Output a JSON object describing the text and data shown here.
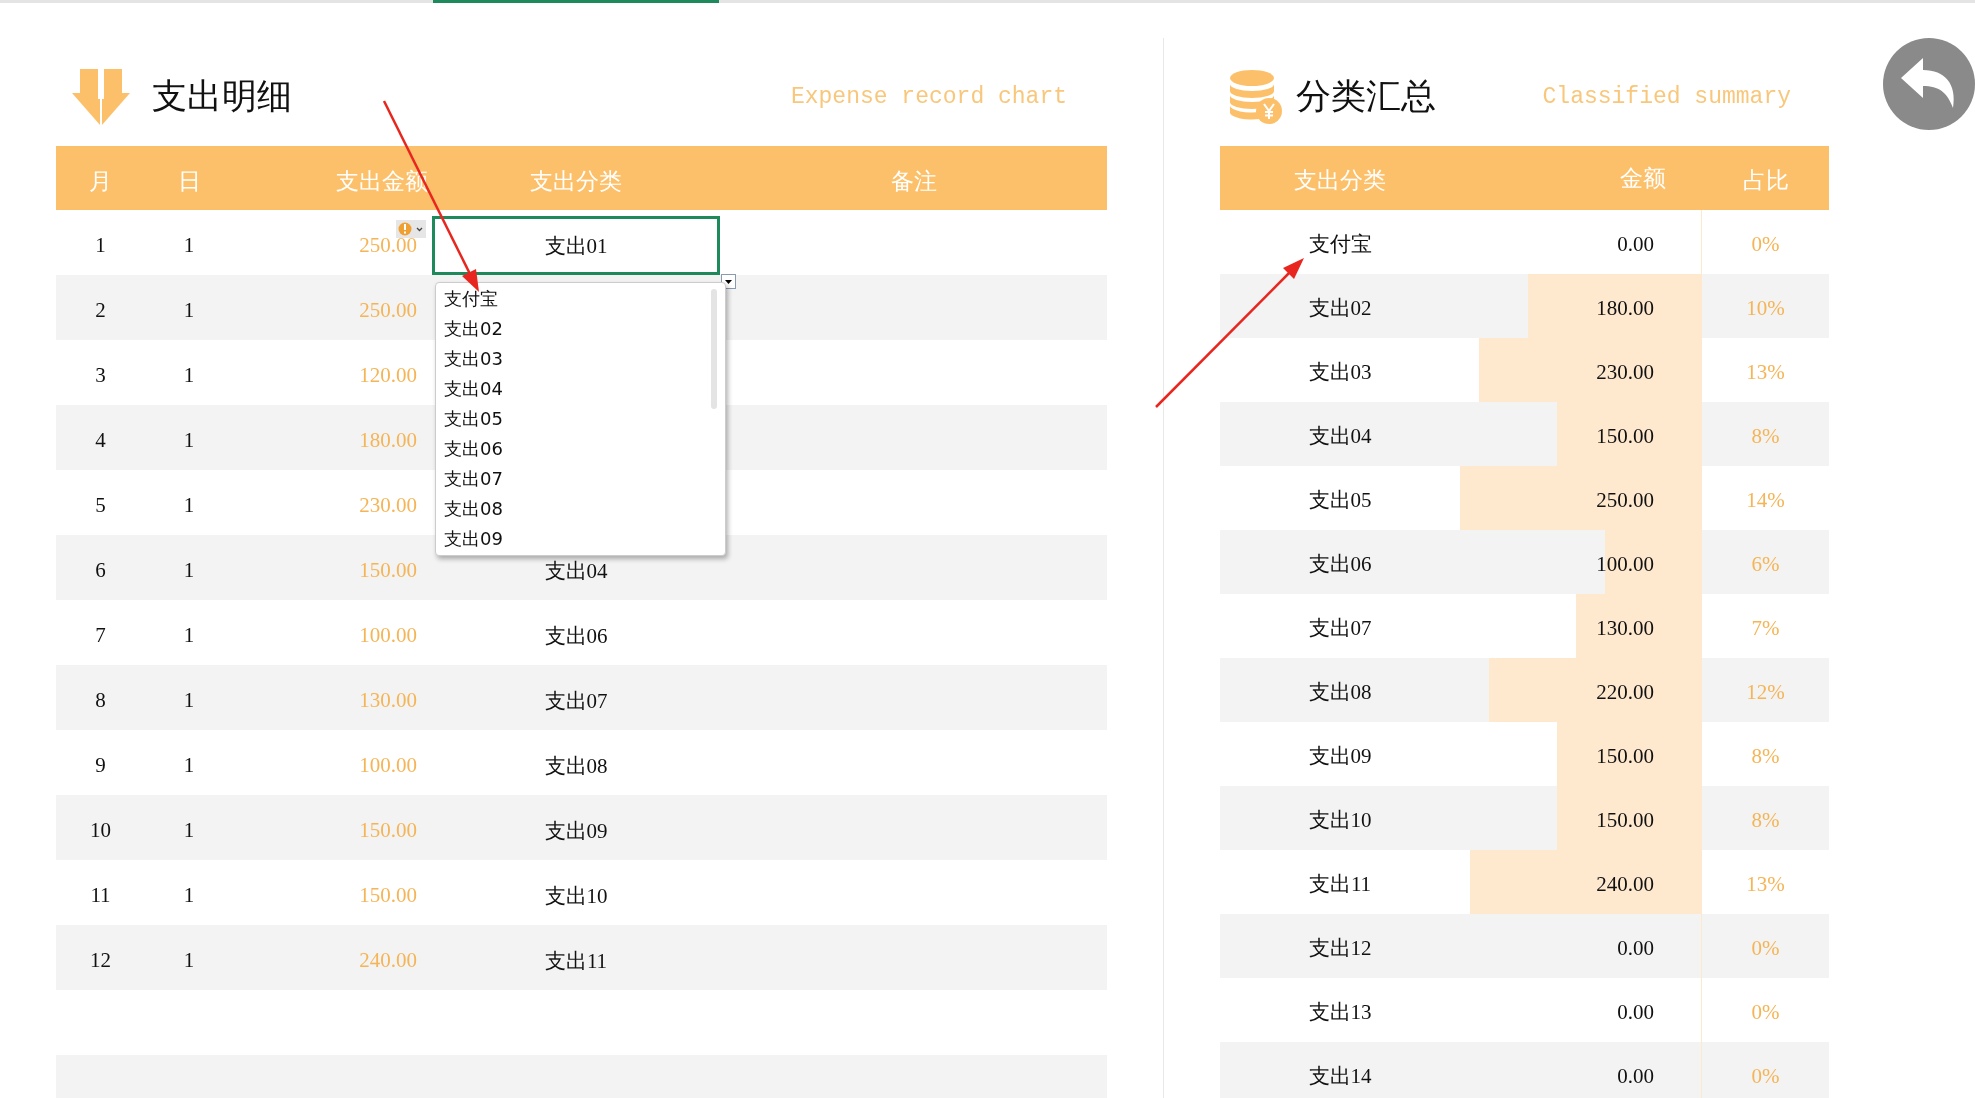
{
  "expense": {
    "title": "支出明细",
    "subtitle": "Expense record chart",
    "columns": [
      "月",
      "日",
      "支出金额",
      "支出分类",
      "备注"
    ],
    "rows": [
      {
        "month": "1",
        "day": "1",
        "amount": "250.00",
        "category": "支出01",
        "selected": true,
        "warning": true
      },
      {
        "month": "2",
        "day": "1",
        "amount": "250.00",
        "selected": false,
        "warning": false
      },
      {
        "month": "3",
        "day": "1",
        "amount": "120.00",
        "selected": false,
        "warning": false
      },
      {
        "month": "4",
        "day": "1",
        "amount": "180.00",
        "selected": false,
        "warning": false
      },
      {
        "month": "5",
        "day": "1",
        "amount": "230.00",
        "selected": false,
        "warning": false
      },
      {
        "month": "6",
        "day": "1",
        "amount": "150.00",
        "category": "支出04",
        "selected": false,
        "warning": false
      },
      {
        "month": "7",
        "day": "1",
        "amount": "100.00",
        "category": "支出06",
        "selected": false,
        "warning": false
      },
      {
        "month": "8",
        "day": "1",
        "amount": "130.00",
        "category": "支出07",
        "selected": false,
        "warning": false
      },
      {
        "month": "9",
        "day": "1",
        "amount": "100.00",
        "category": "支出08",
        "selected": false,
        "warning": false
      },
      {
        "month": "10",
        "day": "1",
        "amount": "150.00",
        "category": "支出09",
        "selected": false,
        "warning": false
      },
      {
        "month": "11",
        "day": "1",
        "amount": "150.00",
        "category": "支出10",
        "selected": false,
        "warning": false
      },
      {
        "month": "12",
        "day": "1",
        "amount": "240.00",
        "category": "支出11",
        "selected": false,
        "warning": false
      }
    ],
    "dropdown": {
      "items": [
        "支付宝",
        "支出02",
        "支出03",
        "支出04",
        "支出05",
        "支出06",
        "支出07",
        "支出08",
        "支出09"
      ]
    }
  },
  "summary": {
    "title": "分类汇总",
    "subtitle": "Classified summary",
    "columns": [
      "支出分类",
      "金额",
      "占比"
    ],
    "rows": [
      {
        "category": "支付宝",
        "amount": "0.00",
        "share": "0%",
        "level": 0
      },
      {
        "category": "支出02",
        "amount": "180.00",
        "share": "10%",
        "level": 0.72
      },
      {
        "category": "支出03",
        "amount": "230.00",
        "share": "13%",
        "level": 0.92
      },
      {
        "category": "支出04",
        "amount": "150.00",
        "share": "8%",
        "level": 0.6
      },
      {
        "category": "支出05",
        "amount": "250.00",
        "share": "14%",
        "level": 1
      },
      {
        "category": "支出06",
        "amount": "100.00",
        "share": "6%",
        "level": 0.4
      },
      {
        "category": "支出07",
        "amount": "130.00",
        "share": "7%",
        "level": 0.52
      },
      {
        "category": "支出08",
        "amount": "220.00",
        "share": "12%",
        "level": 0.88
      },
      {
        "category": "支出09",
        "amount": "150.00",
        "share": "8%",
        "level": 0.6
      },
      {
        "category": "支出10",
        "amount": "150.00",
        "share": "8%",
        "level": 0.6
      },
      {
        "category": "支出11",
        "amount": "240.00",
        "share": "13%",
        "level": 0.96
      },
      {
        "category": "支出12",
        "amount": "0.00",
        "share": "0%",
        "level": 0
      },
      {
        "category": "支出13",
        "amount": "0.00",
        "share": "0%",
        "level": 0
      },
      {
        "category": "支出14",
        "amount": "0.00",
        "share": "0%",
        "level": 0
      }
    ]
  }
}
